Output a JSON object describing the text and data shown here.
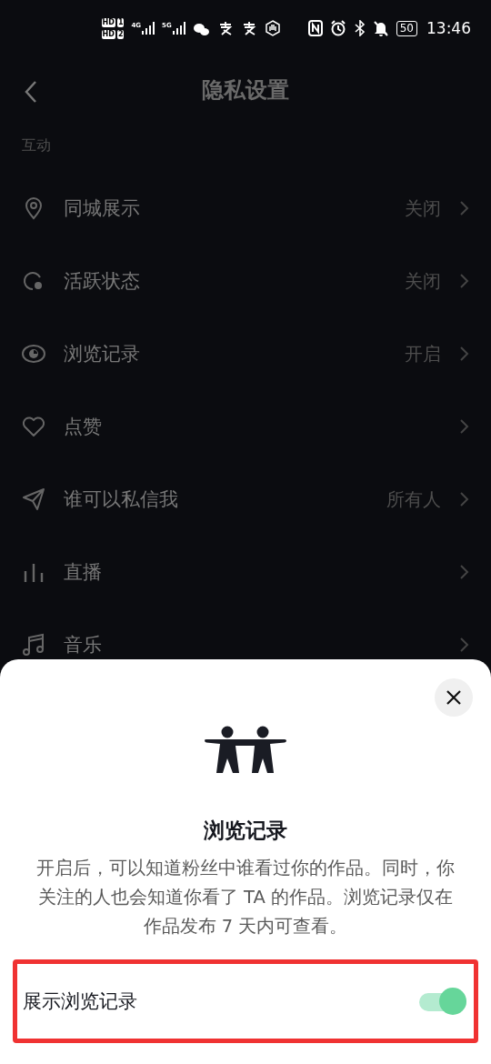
{
  "status_bar": {
    "sims": [
      {
        "label": "HD",
        "slot": "1"
      },
      {
        "label": "HD",
        "slot": "2"
      }
    ],
    "networks": [
      "4G",
      "5G"
    ],
    "battery": "50",
    "time": "13:46"
  },
  "header": {
    "title": "隐私设置"
  },
  "section": {
    "title": "互动",
    "items": [
      {
        "kind": "location",
        "label": "同城展示",
        "value": "关闭"
      },
      {
        "kind": "activity",
        "label": "活跃状态",
        "value": "关闭"
      },
      {
        "kind": "eye",
        "label": "浏览记录",
        "value": "开启"
      },
      {
        "kind": "heart",
        "label": "点赞"
      },
      {
        "kind": "send",
        "label": "谁可以私信我",
        "value": "所有人"
      },
      {
        "kind": "bars",
        "label": "直播"
      },
      {
        "kind": "music",
        "label": "音乐"
      }
    ]
  },
  "sheet": {
    "title": "浏览记录",
    "description": "开启后，可以知道粉丝中谁看过你的作品。同时，你关注的人也会知道你看了 TA 的作品。浏览记录仅在作品发布 7 天内可查看。",
    "toggle": {
      "label": "展示浏览记录",
      "on": true,
      "highlighted": true
    }
  }
}
